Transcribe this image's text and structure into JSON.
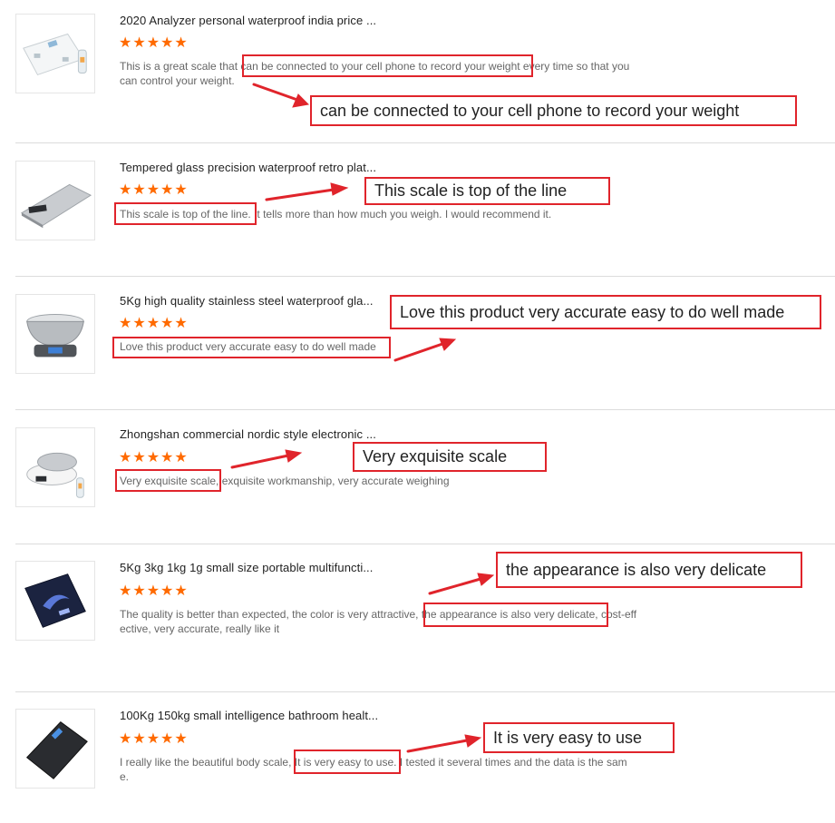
{
  "reviews": [
    {
      "product_title": "2020 Analyzer personal waterproof india price ...",
      "rating": 5,
      "stars": "★★★★★",
      "text_lines": [
        "This is a great scale that can be connected to your cell phone to record your weight every time so that you",
        "can control your weight."
      ],
      "callout": "can be connected to your cell phone to record your weight",
      "image_icon": "body-fat-scale-icon"
    },
    {
      "product_title": "Tempered glass precision waterproof retro plat...",
      "rating": 5,
      "stars": "★★★★★",
      "text_lines": [
        "This scale is top of the line. It tells more than how much you weigh. I would recommend it."
      ],
      "callout": "This scale is top of the line",
      "image_icon": "glass-platform-scale-icon"
    },
    {
      "product_title": "5Kg high quality stainless steel waterproof gla...",
      "rating": 5,
      "stars": "★★★★★",
      "text_lines": [
        "Love this product very accurate easy to do well made"
      ],
      "callout": "Love this product very accurate easy to do well made",
      "image_icon": "bowl-kitchen-scale-icon"
    },
    {
      "product_title": "Zhongshan commercial nordic style electronic ...",
      "rating": 5,
      "stars": "★★★★★",
      "text_lines": [
        "Very exquisite scale, exquisite workmanship, very accurate weighing"
      ],
      "callout": "Very exquisite scale",
      "image_icon": "round-kitchen-scale-icon"
    },
    {
      "product_title": "5Kg 3kg 1kg 1g small size portable multifuncti...",
      "rating": 5,
      "stars": "★★★★★",
      "text_lines": [
        "The quality is better than expected, the color is very attractive, the appearance is also very delicate, cost-eff",
        "ective, very accurate, really like it"
      ],
      "callout": "the appearance is also very delicate",
      "image_icon": "portable-kitchen-scale-icon"
    },
    {
      "product_title": "100Kg 150kg small intelligence bathroom healt...",
      "rating": 5,
      "stars": "★★★★★",
      "text_lines": [
        "I really like the beautiful body scale, It is very easy to use. I tested it several times and the data is the sam",
        "e."
      ],
      "callout": "It is very easy to use",
      "image_icon": "bathroom-scale-icon"
    }
  ],
  "colors": {
    "star": "#ff6a00",
    "highlight": "#e0242b",
    "divider": "#dcdcdc"
  }
}
